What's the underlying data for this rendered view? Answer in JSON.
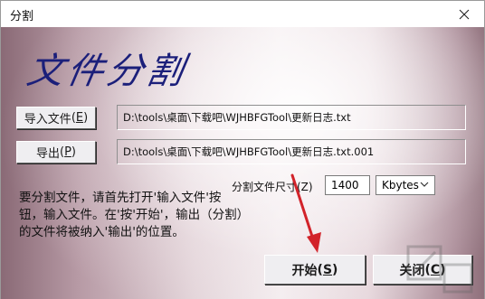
{
  "window": {
    "title": "分割"
  },
  "main": {
    "heading": "文件分割",
    "import_button": {
      "label": "导入文件",
      "shortcut": "(E)"
    },
    "import_path": "D:\\tools\\桌面\\下载吧\\WJHBFGTool\\更新日志.txt",
    "export_button": {
      "label": "导出",
      "shortcut": "(P)"
    },
    "export_path": "D:\\tools\\桌面\\下载吧\\WJHBFGTool\\更新日志.txt.001",
    "size_label": "分割文件尺寸(Z)",
    "size_value": "1400",
    "unit_selected": "Kbytes",
    "description": "要分割文件，请首先打开'输入文件'按钮，输入文件。在'按'开始'，输出（分割）的文件将被纳入'输出'的位置。",
    "start_button": {
      "label": "开始",
      "shortcut": "(S)"
    },
    "close_button": {
      "label": "关闭",
      "shortcut": "(C)"
    }
  },
  "colors": {
    "heading": "#1b1f7a",
    "arrow": "#d2232a"
  },
  "icons": [
    "close-icon",
    "chevron-down-icon",
    "red-arrow-annotation"
  ]
}
